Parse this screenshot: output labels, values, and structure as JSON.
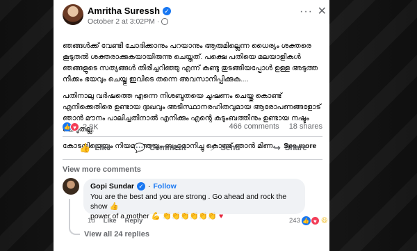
{
  "post": {
    "author": "Amritha Suressh",
    "timestamp": "October 2 at 3:02PM",
    "paragraphs": [
      "ഞങ്ങൾക്ക് വേണ്ടി ചോദിക്കാനും പറയാനും ആരുമില്ലെന്ന ധൈര്യം ശക്തരെ കൂടുതൽ ശക്തരാക്കുകയായിരുന്നു ചെയ്തത്. പക്ഷെ പതിയെ മലയാളികൾ ഞങ്ങളുടെ സത്യങ്ങൾ തിരിച്ചറിഞ്ഞു എന്ന് കണ്ടു തുടങ്ങിയപ്പോൾ ഉള്ള അടുത്ത നീക്കം ഭയവും ചെയ്തു ഇവിടെ തന്നെ അവസാനിപ്പിക്കുക....",
      "പതിനാലു വർഷത്തെ എന്നെ നിശബ്ദതയെ ചൂഷണം ചെയ്തു കൊണ്ട് എനിക്കെതിരെ ഉണ്ടായ ദുഃഖവും അടിസ്ഥാനരഹിതവുമായ ആരോപണങ്ങളോട് ഞാൻ മൗനം പാലിച്ചതിനാൽ എനിക്കും എന്റെ കുടുംബത്തിനും ഉണ്ടായ നഷ്ടം ചെറുതല്ല.",
      "കോടതിയെയും നിയമത്തെയും ബഹുമാനിച്ചു കൊണ്ട് ഞാൻ മിണ...."
    ],
    "see_more": "See more",
    "reaction_count": "2.8K",
    "comments_count": "466 comments",
    "shares_count": "18 shares"
  },
  "actions": {
    "like": "Like",
    "comment": "Comment",
    "send": "Send",
    "share": "Share"
  },
  "view_more_comments": "View more comments",
  "comment": {
    "name": "Gopi Sundar",
    "follow_separator": "·",
    "follow": "Follow",
    "text_line1": "You are the best and you are strong . Go ahead and rock the show",
    "text_line2": "power of a mother",
    "time": "1d",
    "like": "Like",
    "reply": "Reply",
    "reaction_count": "243"
  },
  "view_replies": "View all 24 replies",
  "colors": {
    "accent": "#1877f2",
    "love": "#f33e58",
    "muted": "#65676b"
  }
}
